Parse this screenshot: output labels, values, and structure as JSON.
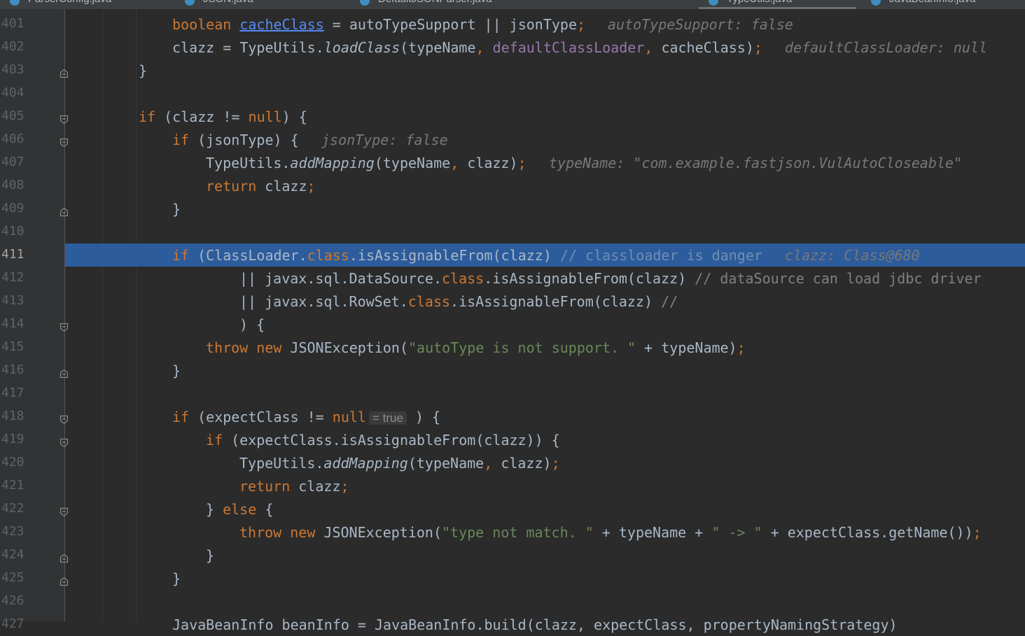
{
  "tabs": [
    {
      "label": "ParserConfig.java",
      "active": false
    },
    {
      "label": "JSON.java",
      "active": false
    },
    {
      "label": "DefaultJSONParser.java",
      "active": false
    },
    {
      "label": "TypeUtils.java",
      "active": true
    },
    {
      "label": "JavaBeanInfo.java",
      "active": false
    }
  ],
  "lines": [
    {
      "num": "401",
      "indent": 3,
      "tokens": [
        {
          "t": "boolean ",
          "c": "kw"
        },
        {
          "t": "cacheClass",
          "c": "lnk"
        },
        {
          "t": " = autoTypeSupport || jsonType"
        },
        {
          "t": ";",
          "c": "kw"
        }
      ],
      "hint": "autoTypeSupport: false"
    },
    {
      "num": "402",
      "indent": 3,
      "tokens": [
        {
          "t": "clazz = TypeUtils."
        },
        {
          "t": "loadClass",
          "c": "it"
        },
        {
          "t": "(typeName"
        },
        {
          "t": ", ",
          "c": "kw"
        },
        {
          "t": "defaultClassLoader",
          "c": "fld"
        },
        {
          "t": ", ",
          "c": "kw"
        },
        {
          "t": "cacheClass)"
        },
        {
          "t": ";",
          "c": "kw"
        }
      ],
      "hint": "defaultClassLoader: null"
    },
    {
      "num": "403",
      "indent": 2,
      "fold": "end",
      "tokens": [
        {
          "t": "}"
        }
      ]
    },
    {
      "num": "404",
      "indent": 0,
      "tokens": []
    },
    {
      "num": "405",
      "indent": 2,
      "fold": "start",
      "tokens": [
        {
          "t": "if ",
          "c": "kw"
        },
        {
          "t": "(clazz != "
        },
        {
          "t": "null",
          "c": "kw"
        },
        {
          "t": ") {"
        }
      ]
    },
    {
      "num": "406",
      "indent": 3,
      "fold": "start",
      "tokens": [
        {
          "t": "if ",
          "c": "kw"
        },
        {
          "t": "(jsonType) {"
        }
      ],
      "hint": "jsonType: false"
    },
    {
      "num": "407",
      "indent": 4,
      "tokens": [
        {
          "t": "TypeUtils."
        },
        {
          "t": "addMapping",
          "c": "it"
        },
        {
          "t": "(typeName"
        },
        {
          "t": ", ",
          "c": "kw"
        },
        {
          "t": "clazz)"
        },
        {
          "t": ";",
          "c": "kw"
        }
      ],
      "hint": "typeName: \"com.example.fastjson.VulAutoCloseable\""
    },
    {
      "num": "408",
      "indent": 4,
      "tokens": [
        {
          "t": "return ",
          "c": "kw"
        },
        {
          "t": "clazz"
        },
        {
          "t": ";",
          "c": "kw"
        }
      ]
    },
    {
      "num": "409",
      "indent": 3,
      "fold": "end",
      "tokens": [
        {
          "t": "}"
        }
      ]
    },
    {
      "num": "410",
      "indent": 0,
      "tokens": []
    },
    {
      "num": "411",
      "indent": 3,
      "highlight": true,
      "tokens": [
        {
          "t": "if ",
          "c": "kw"
        },
        {
          "t": "(ClassLoader."
        },
        {
          "t": "class",
          "c": "kw"
        },
        {
          "t": ".isAssignableFrom(clazz) "
        },
        {
          "t": "// classloader is danger",
          "c": "com"
        }
      ],
      "hint": "clazz: Class@680"
    },
    {
      "num": "412",
      "indent": 5,
      "tokens": [
        {
          "t": "|| javax.sql.DataSource."
        },
        {
          "t": "class",
          "c": "kw"
        },
        {
          "t": ".isAssignableFrom(clazz) "
        },
        {
          "t": "// dataSource can load jdbc driver",
          "c": "com"
        }
      ]
    },
    {
      "num": "413",
      "indent": 5,
      "tokens": [
        {
          "t": "|| javax.sql.RowSet."
        },
        {
          "t": "class",
          "c": "kw"
        },
        {
          "t": ".isAssignableFrom(clazz) "
        },
        {
          "t": "//",
          "c": "com"
        }
      ]
    },
    {
      "num": "414",
      "indent": 5,
      "fold": "start",
      "tokens": [
        {
          "t": ") {"
        }
      ]
    },
    {
      "num": "415",
      "indent": 4,
      "tokens": [
        {
          "t": "throw new ",
          "c": "kw"
        },
        {
          "t": "JSONException("
        },
        {
          "t": "\"autoType is not support. \"",
          "c": "str"
        },
        {
          "t": " + typeName)"
        },
        {
          "t": ";",
          "c": "kw"
        }
      ]
    },
    {
      "num": "416",
      "indent": 3,
      "fold": "end",
      "tokens": [
        {
          "t": "}"
        }
      ]
    },
    {
      "num": "417",
      "indent": 0,
      "tokens": []
    },
    {
      "num": "418",
      "indent": 3,
      "fold": "start",
      "tokens": [
        {
          "t": "if ",
          "c": "kw"
        },
        {
          "t": "(expectClass != "
        },
        {
          "t": "null",
          "c": "kw"
        },
        {
          "t": "= true",
          "c": "inlay"
        },
        {
          "t": " ) {"
        }
      ]
    },
    {
      "num": "419",
      "indent": 4,
      "fold": "start",
      "tokens": [
        {
          "t": "if ",
          "c": "kw"
        },
        {
          "t": "(expectClass.isAssignableFrom(clazz)) {"
        }
      ]
    },
    {
      "num": "420",
      "indent": 5,
      "tokens": [
        {
          "t": "TypeUtils."
        },
        {
          "t": "addMapping",
          "c": "it"
        },
        {
          "t": "(typeName"
        },
        {
          "t": ", ",
          "c": "kw"
        },
        {
          "t": "clazz)"
        },
        {
          "t": ";",
          "c": "kw"
        }
      ]
    },
    {
      "num": "421",
      "indent": 5,
      "tokens": [
        {
          "t": "return ",
          "c": "kw"
        },
        {
          "t": "clazz"
        },
        {
          "t": ";",
          "c": "kw"
        }
      ]
    },
    {
      "num": "422",
      "indent": 4,
      "fold": "start",
      "tokens": [
        {
          "t": "} "
        },
        {
          "t": "else ",
          "c": "kw"
        },
        {
          "t": "{"
        }
      ]
    },
    {
      "num": "423",
      "indent": 5,
      "tokens": [
        {
          "t": "throw new ",
          "c": "kw"
        },
        {
          "t": "JSONException("
        },
        {
          "t": "\"type not match. \"",
          "c": "str"
        },
        {
          "t": " + typeName + "
        },
        {
          "t": "\" -> \"",
          "c": "str"
        },
        {
          "t": " + expectClass.getName())"
        },
        {
          "t": ";",
          "c": "kw"
        }
      ]
    },
    {
      "num": "424",
      "indent": 4,
      "fold": "end",
      "tokens": [
        {
          "t": "}"
        }
      ]
    },
    {
      "num": "425",
      "indent": 3,
      "fold": "end",
      "tokens": [
        {
          "t": "}"
        }
      ]
    },
    {
      "num": "426",
      "indent": 0,
      "tokens": []
    },
    {
      "num": "427",
      "indent": 3,
      "tokens": [
        {
          "t": "JavaBeanInfo beanInfo = JavaBeanInfo.build(clazz, expectClass, propertyNamingStrategy)"
        }
      ]
    }
  ]
}
